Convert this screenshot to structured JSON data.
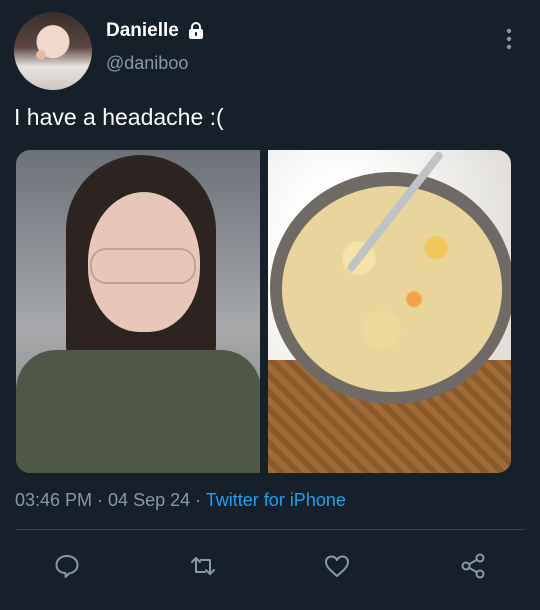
{
  "user": {
    "display_name": "Danielle",
    "handle": "@daniboo",
    "protected": true
  },
  "tweet": {
    "text": "I have a headache :(",
    "time": "03:46 PM",
    "separator": " · ",
    "date": "04 Sep 24",
    "source": "Twitter for iPhone"
  },
  "media": [
    {
      "kind": "photo",
      "subject": "selfie"
    },
    {
      "kind": "photo",
      "subject": "soup-bowl"
    }
  ],
  "icons": {
    "lock": "lock-icon",
    "more": "more-vertical-icon",
    "reply": "reply-icon",
    "retweet": "retweet-icon",
    "like": "heart-icon",
    "share": "share-icon"
  },
  "colors": {
    "background": "#15202b",
    "text": "#ffffff",
    "muted": "#8899a6",
    "link": "#1da1f2",
    "divider": "#38444d"
  }
}
